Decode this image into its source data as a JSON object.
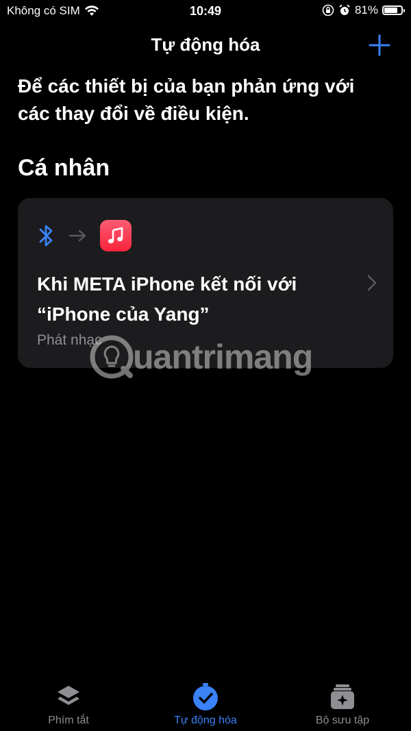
{
  "status_bar": {
    "carrier": "Không có SIM",
    "time": "10:49",
    "battery_percent": "81%",
    "battery_level": 0.81
  },
  "nav": {
    "title": "Tự động hóa"
  },
  "description": "Để các thiết bị của bạn phản ứng với các thay đổi về điều kiện.",
  "section": {
    "title": "Cá nhân"
  },
  "automation_card": {
    "trigger_icon": "bluetooth-icon",
    "arrow_icon": "arrow-right-icon",
    "action_icon": "music-app-icon",
    "title": "Khi META iPhone kết nối với “iPhone của Yang”",
    "subtitle": "Phát nhạc"
  },
  "watermark": {
    "text": "uantrimang"
  },
  "tabs": [
    {
      "label": "Phím tắt",
      "icon": "layers-icon",
      "active": false
    },
    {
      "label": "Tự động hóa",
      "icon": "clock-check-icon",
      "active": true
    },
    {
      "label": "Bộ sưu tập",
      "icon": "gallery-sparkle-icon",
      "active": false
    }
  ],
  "colors": {
    "accent": "#3a82f6",
    "background": "#000000",
    "card": "#1c1c1e",
    "secondary_text": "#8e8e93",
    "music_red": "#fa233b"
  }
}
